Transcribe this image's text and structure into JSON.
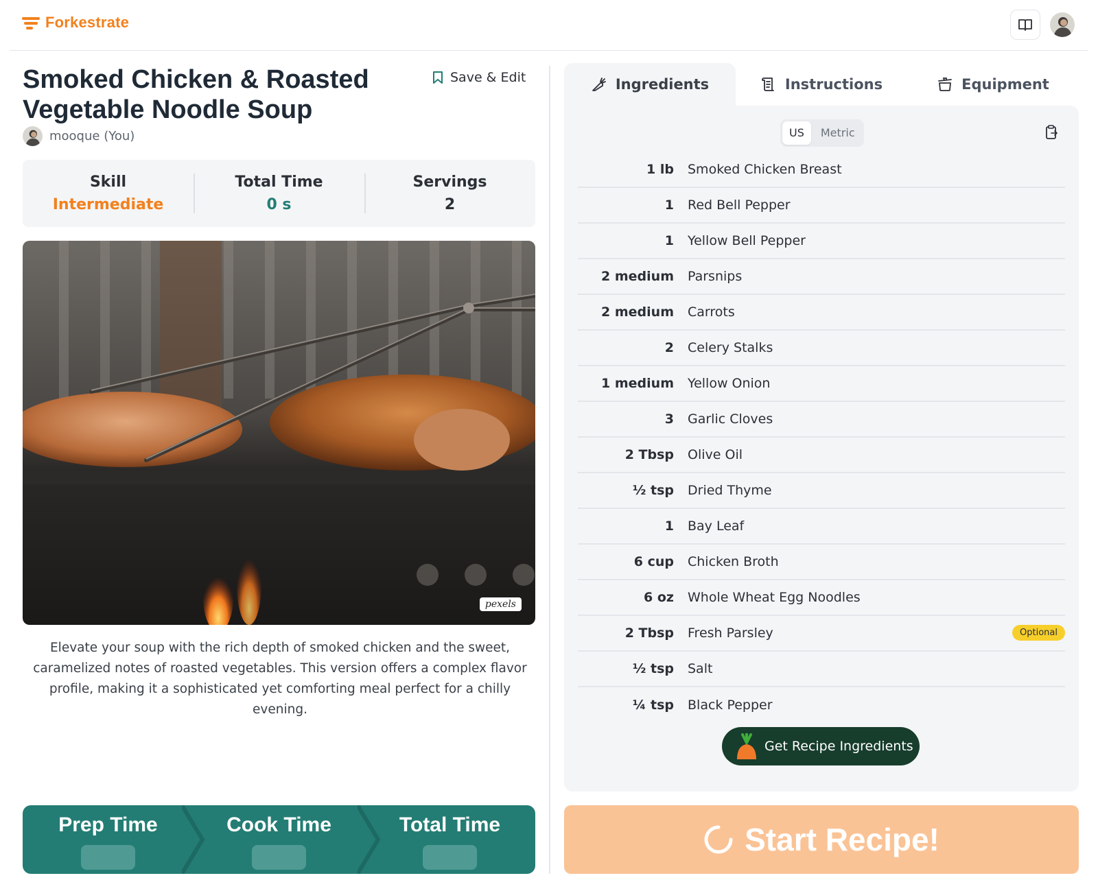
{
  "header": {
    "brand": "Forkestrate",
    "book_icon": "book-open-icon",
    "avatar": "user-avatar"
  },
  "recipe": {
    "title": "Smoked Chicken & Roasted Vegetable Noodle Soup",
    "save_label": "Save & Edit",
    "author": "mooque (You)",
    "description": "Elevate your soup with the rich depth of smoked chicken and the sweet, caramelized notes of roasted vegetables. This version offers a complex flavor profile, making it a sophisticated yet comforting meal perfect for a chilly evening.",
    "image_credit": "pexels"
  },
  "stats": [
    {
      "label": "Skill",
      "value": "Intermediate",
      "color": "#f2811d"
    },
    {
      "label": "Total Time",
      "value": "0 s",
      "color": "#247d74"
    },
    {
      "label": "Servings",
      "value": "2",
      "color": "#2b2f36"
    }
  ],
  "time_bar": [
    "Prep Time",
    "Cook Time",
    "Total Time"
  ],
  "tabs": [
    {
      "label": "Ingredients",
      "icon": "carrot-icon",
      "active": true
    },
    {
      "label": "Instructions",
      "icon": "scroll-icon",
      "active": false
    },
    {
      "label": "Equipment",
      "icon": "pot-icon",
      "active": false
    }
  ],
  "units": {
    "us": "US",
    "metric": "Metric",
    "selected": "US"
  },
  "ingredients": [
    {
      "qty": "1 lb",
      "name": "Smoked Chicken Breast"
    },
    {
      "qty": "1",
      "name": "Red Bell Pepper"
    },
    {
      "qty": "1",
      "name": "Yellow Bell Pepper"
    },
    {
      "qty": "2 medium",
      "name": "Parsnips"
    },
    {
      "qty": "2 medium",
      "name": "Carrots"
    },
    {
      "qty": "2",
      "name": "Celery Stalks"
    },
    {
      "qty": "1 medium",
      "name": "Yellow Onion"
    },
    {
      "qty": "3",
      "name": "Garlic Cloves"
    },
    {
      "qty": "2 Tbsp",
      "name": "Olive Oil"
    },
    {
      "qty": "½ tsp",
      "name": "Dried Thyme"
    },
    {
      "qty": "1",
      "name": "Bay Leaf"
    },
    {
      "qty": "6 cup",
      "name": "Chicken Broth"
    },
    {
      "qty": "6 oz",
      "name": "Whole Wheat Egg Noodles"
    },
    {
      "qty": "2 Tbsp",
      "name": "Fresh Parsley",
      "badge": "Optional"
    },
    {
      "qty": "½ tsp",
      "name": "Salt"
    },
    {
      "qty": "¼ tsp",
      "name": "Black Pepper"
    }
  ],
  "get_ingredients_label": "Get Recipe Ingredients",
  "start_label": "Start Recipe!",
  "colors": {
    "brand": "#f2811d",
    "teal": "#247d74",
    "start_bg": "#fac396",
    "dark_green": "#173d2c",
    "optional_badge": "#f7cf2b"
  }
}
